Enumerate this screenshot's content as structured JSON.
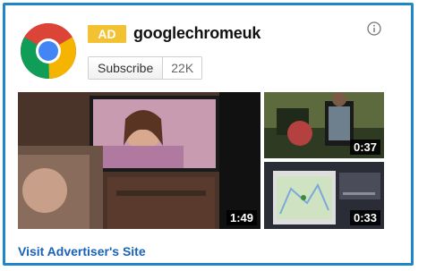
{
  "ad": {
    "badge": "AD",
    "channel_name": "googlechromeuk",
    "subscribe_label": "Subscribe",
    "subscriber_count": "22K",
    "visit_link": "Visit Advertiser's Site"
  },
  "videos": [
    {
      "duration": "1:49"
    },
    {
      "duration": "0:37"
    },
    {
      "duration": "0:33"
    }
  ],
  "colors": {
    "frame_border": "#1f87c8",
    "ad_badge": "#f2c233",
    "link": "#1a62b5"
  },
  "icons": {
    "logo": "chrome-logo-icon",
    "info": "info-icon"
  }
}
